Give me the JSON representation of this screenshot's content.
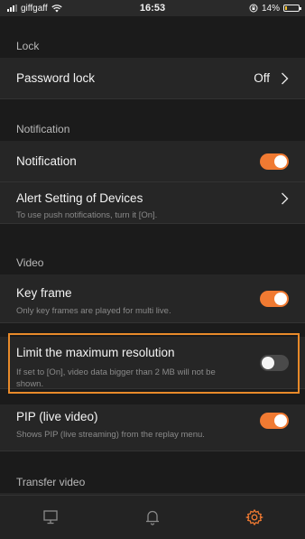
{
  "status_bar": {
    "carrier": "giffgaff",
    "time": "16:53",
    "battery": "14%",
    "battery_level": 0.14
  },
  "sections": {
    "lock": {
      "header": "Lock",
      "password_lock": {
        "label": "Password lock",
        "value": "Off"
      }
    },
    "notification": {
      "header": "Notification",
      "notification": {
        "label": "Notification",
        "enabled": true
      },
      "alert_setting": {
        "label": "Alert Setting of Devices",
        "description": "To use push notifications, turn it [On]."
      }
    },
    "video": {
      "header": "Video",
      "key_frame": {
        "label": "Key frame",
        "description": "Only key frames are played for multi live.",
        "enabled": true
      },
      "limit_resolution": {
        "label": "Limit the maximum resolution",
        "description": "If set to [On], video data bigger than 2 MB will not be shown.",
        "enabled": false
      },
      "pip": {
        "label": "PIP (live video)",
        "description": "Shows PIP (live streaming) from the replay menu.",
        "enabled": true
      }
    },
    "transfer_video": {
      "header": "Transfer video"
    }
  },
  "tab_bar": {
    "tabs": [
      {
        "icon": "monitor-icon",
        "active": false
      },
      {
        "icon": "bell-icon",
        "active": false
      },
      {
        "icon": "gear-icon",
        "active": true
      }
    ]
  },
  "colors": {
    "accent": "#f07a32",
    "highlight": "#e88a2a",
    "background": "#1b1b1b",
    "row_background": "#262626"
  }
}
